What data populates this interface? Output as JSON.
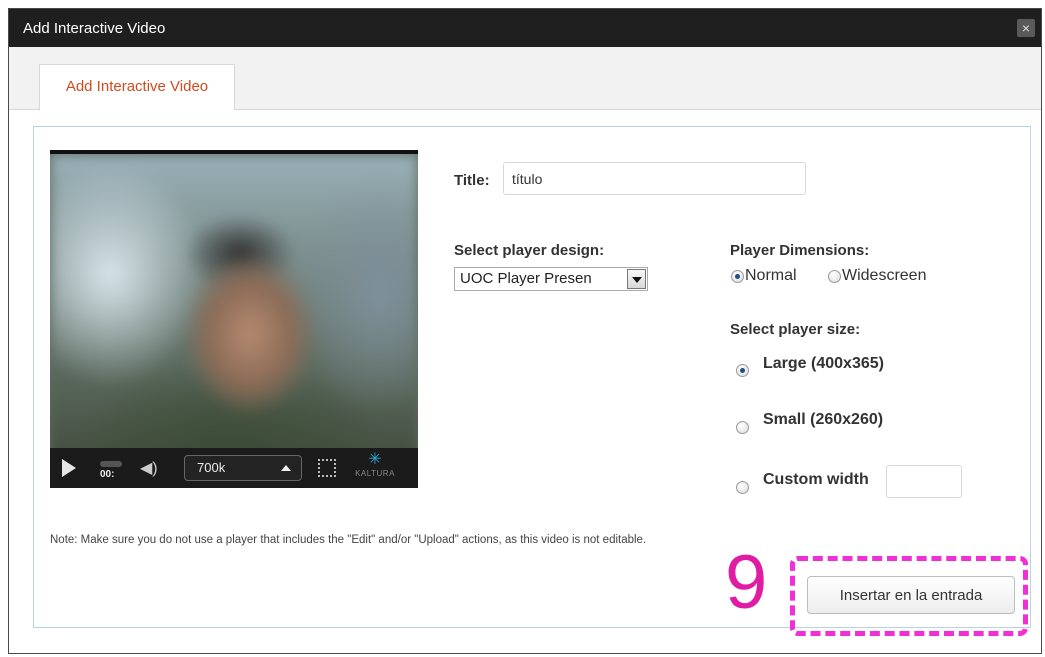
{
  "window": {
    "title": "Add Interactive Video",
    "close_label": "×"
  },
  "tabs": [
    {
      "label": "Add Interactive Video",
      "active": true
    }
  ],
  "player": {
    "time": "00:",
    "quality": "700k",
    "brand": "KALTURA"
  },
  "form": {
    "title_label": "Title:",
    "title_value": "título",
    "design_label": "Select player design:",
    "design_value": "UOC Player Presen",
    "dimensions_label": "Player Dimensions:",
    "dimension_options": [
      {
        "label": "Normal",
        "selected": true
      },
      {
        "label": "Widescreen",
        "selected": false
      }
    ],
    "size_label": "Select player size:",
    "size_options": [
      {
        "label": "Large (400x365)",
        "selected": true
      },
      {
        "label": "Small (260x260)",
        "selected": false
      },
      {
        "label": "Custom width",
        "selected": false
      }
    ],
    "custom_width_value": ""
  },
  "note": "Note: Make sure you do not use a player that includes the \"Edit\" and/or \"Upload\" actions, as this video is not editable.",
  "annotation": {
    "step_number": "9",
    "color": "#f02fd6"
  },
  "actions": {
    "insert_label": "Insertar en la entrada"
  },
  "colors": {
    "titlebar": "#1f1f1f",
    "tab_text": "#d14a1f",
    "panel_border": "#b7d3e3"
  }
}
